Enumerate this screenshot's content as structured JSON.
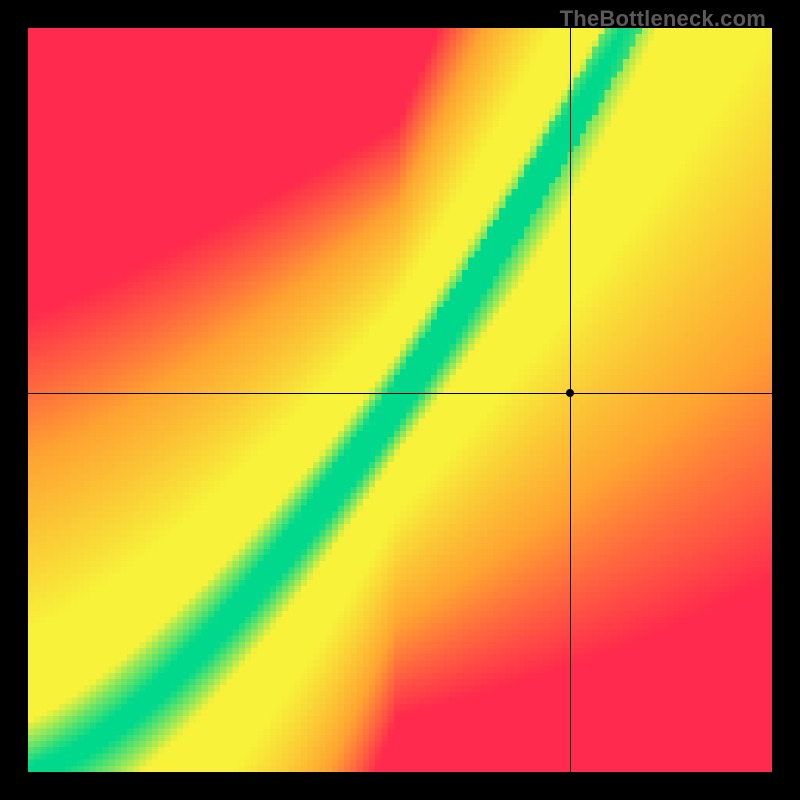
{
  "watermark": {
    "text": "TheBottleneck.com"
  },
  "chart_data": {
    "type": "heatmap",
    "title": "",
    "xlabel": "",
    "ylabel": "",
    "xlim": [
      0,
      1
    ],
    "ylim": [
      0,
      1
    ],
    "optimal_curve": {
      "description": "Green optimal band rising from bottom-left to upper-right, slightly convex; origin at (0,0), passes near (0.73,0.51)",
      "type": "power",
      "a": 1.38,
      "gamma": 1.45,
      "band_halfwidth_min": 0.01,
      "band_halfwidth_max": 0.055
    },
    "marker": {
      "x": 0.728,
      "y": 0.51
    },
    "crosshair": {
      "x": 0.728,
      "y": 0.51
    },
    "colors": {
      "optimal": "#00D98B",
      "near": "#F8F23A",
      "mid": "#FFA332",
      "far": "#FF2A4D"
    },
    "grid": 120
  }
}
